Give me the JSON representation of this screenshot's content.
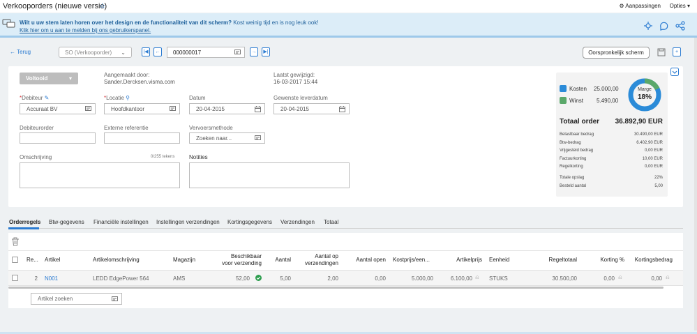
{
  "header": {
    "title": "Verkooporders (nieuwe versie)",
    "customizations": "Aanpassingen",
    "options": "Opties"
  },
  "banner": {
    "question": "Wilt u uw stem laten horen over het design en de functionaliteit van dit scherm?",
    "sub": "Kost weinig tijd en is nog leuk ook!",
    "link": "Klik hier om u aan te melden bij ons gebruikerspanel."
  },
  "toolbar": {
    "back": "Terug",
    "order_type": "SO (Verkooporder)",
    "order_number": "000000017",
    "original_screen": "Oorspronkelijk scherm"
  },
  "form": {
    "status": "Voltooid",
    "created_by_label": "Aangemaakt door:",
    "created_by": "Sander.Dercksen.visma.com",
    "last_modified_label": "Laatst gewijzigd:",
    "last_modified": "16-03-2017 15:44",
    "debtor_label": "Debiteur",
    "debtor": "Accuraat BV",
    "location_label": "Locatie",
    "location": "Hoofdkantoor",
    "date_label": "Datum",
    "date": "20-04-2015",
    "delivery_label": "Gewenste leverdatum",
    "delivery": "20-04-2015",
    "debtor_order_label": "Debiteurorder",
    "external_ref_label": "Externe referentie",
    "carrier_label": "Vervoersmethode",
    "carrier_placeholder": "Zoeken naar...",
    "description_label": "Omschrijving",
    "description_counter": "0/255 tekens",
    "notes_label": "Notities"
  },
  "summary": {
    "costs_label": "Kosten",
    "costs": "25.000,00",
    "profit_label": "Winst",
    "profit": "5.490,00",
    "margin_label": "Marge",
    "margin": "18%",
    "margin_value": 0.18,
    "total_label": "Totaal order",
    "total": "36.892,90 EUR",
    "lines": [
      {
        "label": "Belastbaar bedrag",
        "value": "30.490,00 EUR"
      },
      {
        "label": "Btw-bedrag",
        "value": "6.402,90 EUR"
      },
      {
        "label": "Vrijgesteld bedrag",
        "value": "0,00 EUR"
      },
      {
        "label": "Factuurkorting",
        "value": "10,00 EUR"
      },
      {
        "label": "Regelkorting",
        "value": "0,00 EUR"
      }
    ],
    "extra": [
      {
        "label": "Totale opslag",
        "value": "22%"
      },
      {
        "label": "Besteld aantal",
        "value": "5,00"
      }
    ],
    "colors": {
      "costs": "#2b8bd8",
      "profit": "#5aa86a"
    }
  },
  "tabs": [
    "Orderregels",
    "Btw-gegevens",
    "Financiële instellingen",
    "Instellingen verzendingen",
    "Kortingsgegevens",
    "Verzendingen",
    "Totaal"
  ],
  "grid": {
    "headers": [
      "Re...",
      "Artikel",
      "Artikelomschrijving",
      "Magazijn",
      "Beschikbaar",
      "voor verzending",
      "Aantal",
      "Aantal op",
      "verzendingen",
      "Aantal open",
      "Kostprijs/een...",
      "Artikelprijs",
      "Eenheid",
      "Regeltotaal",
      "Korting %",
      "Kortingsbedrag"
    ],
    "row": {
      "line": "2",
      "item": "N001",
      "description": "LEDD EdgePower 564",
      "warehouse": "AMS",
      "available": "52,00",
      "qty": "5,00",
      "qty_shipments": "2,00",
      "qty_open": "0,00",
      "cost": "5.000,00",
      "price": "6.100,00",
      "unit": "STUKS",
      "total": "30.500,00",
      "discount_pct": "0,00",
      "discount_amount": "0,00"
    },
    "search_placeholder": "Artikel zoeken"
  }
}
